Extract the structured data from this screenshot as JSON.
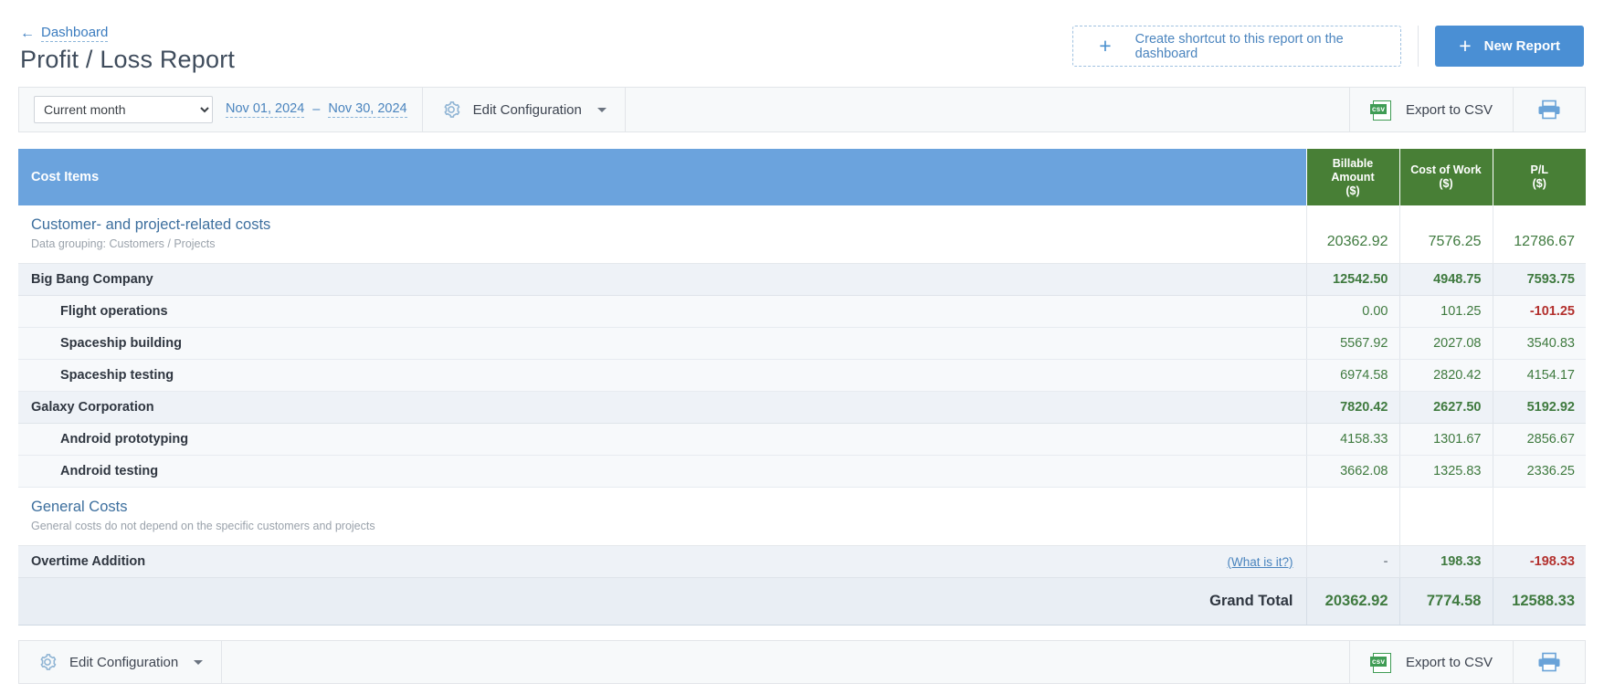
{
  "header": {
    "breadcrumb_label": "Dashboard",
    "back_arrow": "left-arrow-icon",
    "page_title": "Profit / Loss Report",
    "create_shortcut_label": "Create shortcut to this report on the dashboard",
    "new_report_label": "New Report",
    "plus_glyph": "+"
  },
  "toolbar": {
    "period_selected": "Current month",
    "period_options": [
      "Current month"
    ],
    "date_from": "Nov 01, 2024",
    "date_dash": "–",
    "date_to": "Nov 30, 2024",
    "edit_configuration_label": "Edit Configuration",
    "export_csv_label": "Export to CSV",
    "csv_icon_text": "csv",
    "print_icon": "printer-icon",
    "gear_icon": "gear-icon"
  },
  "table": {
    "columns": [
      {
        "label": "Cost Items",
        "type": "text"
      },
      {
        "label": "Billable Amount",
        "unit": "($)",
        "type": "num"
      },
      {
        "label": "Cost of Work",
        "unit": "($)",
        "type": "num"
      },
      {
        "label": "P/L",
        "unit": "($)",
        "type": "num"
      }
    ],
    "sections": [
      {
        "title": "Customer- and project-related costs",
        "subtitle": "Data grouping: Customers / Projects",
        "totals": [
          "20362.92",
          "7576.25",
          "12786.67"
        ],
        "rows": [
          {
            "level": 1,
            "label": "Big Bang Company",
            "values": [
              "12542.50",
              "4948.75",
              "7593.75"
            ],
            "neg": [
              false,
              false,
              false
            ]
          },
          {
            "level": 2,
            "label": "Flight operations",
            "values": [
              "0.00",
              "101.25",
              "-101.25"
            ],
            "neg": [
              false,
              false,
              true
            ]
          },
          {
            "level": 2,
            "label": "Spaceship building",
            "values": [
              "5567.92",
              "2027.08",
              "3540.83"
            ],
            "neg": [
              false,
              false,
              false
            ]
          },
          {
            "level": 2,
            "label": "Spaceship testing",
            "values": [
              "6974.58",
              "2820.42",
              "4154.17"
            ],
            "neg": [
              false,
              false,
              false
            ]
          },
          {
            "level": 1,
            "label": "Galaxy Corporation",
            "values": [
              "7820.42",
              "2627.50",
              "5192.92"
            ],
            "neg": [
              false,
              false,
              false
            ]
          },
          {
            "level": 2,
            "label": "Android prototyping",
            "values": [
              "4158.33",
              "1301.67",
              "2856.67"
            ],
            "neg": [
              false,
              false,
              false
            ]
          },
          {
            "level": 2,
            "label": "Android testing",
            "values": [
              "3662.08",
              "1325.83",
              "2336.25"
            ],
            "neg": [
              false,
              false,
              false
            ]
          }
        ]
      },
      {
        "title": "General Costs",
        "subtitle": "General costs do not depend on the specific customers and projects",
        "totals": [
          "",
          "",
          ""
        ],
        "rows": [
          {
            "level": 1,
            "label": "Overtime Addition",
            "hint": "(What is it?)",
            "values": [
              "-",
              "198.33",
              "-198.33"
            ],
            "neg": [
              false,
              false,
              true
            ],
            "dim": [
              true,
              false,
              false
            ]
          }
        ]
      }
    ],
    "grand_total": {
      "label": "Grand Total",
      "values": [
        "20362.92",
        "7774.58",
        "12588.33"
      ]
    }
  },
  "bottombar": {
    "edit_configuration_label": "Edit Configuration",
    "export_csv_label": "Export to CSV",
    "csv_icon_text": "csv"
  },
  "colors": {
    "accent_blue": "#4a8fd4",
    "header_blue": "#6ba3dd",
    "header_green": "#487f36",
    "positive": "#3f7a3f",
    "negative": "#b3312e"
  }
}
